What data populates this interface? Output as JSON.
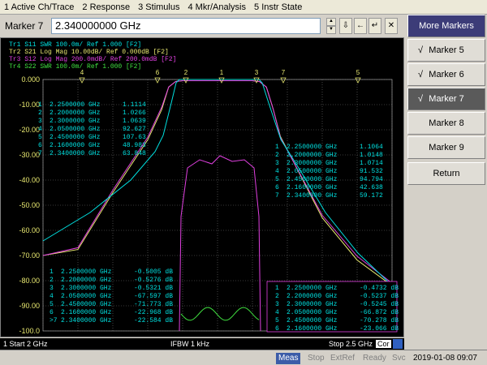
{
  "menu": [
    "1 Active Ch/Trace",
    "2 Response",
    "3 Stimulus",
    "4 Mkr/Analysis",
    "5 Instr State"
  ],
  "entry": {
    "label": "Marker 7",
    "value": "2.340000000 GHz"
  },
  "traces": [
    {
      "text": "Tr1  S11  SWR 100.0m/ Ref 1.000  [F2]",
      "color": "#00e0e0"
    },
    {
      "text": "Tr2  S21  Log Mag 10.00dB/ Ref 0.000dB  [F2]",
      "color": "#e8e870"
    },
    {
      "text": "Tr3  S12  Log Mag 200.0mdB/ Ref 200.0mdB  [F2]",
      "color": "#e040e0"
    },
    {
      "text": "Tr4  S22  SWR 100.0m/ Ref 1.000  [F2]",
      "color": "#40e040"
    }
  ],
  "y_axis": [
    "0.000",
    "-10.00",
    "-20.00",
    "-30.00",
    "-40.00",
    "-50.00",
    "-60.00",
    "-70.00",
    "-80.00",
    "-90.00",
    "-100.0"
  ],
  "colors": {
    "tr1": "#00e0e0",
    "tr2": "#e8e870",
    "tr3": "#e040e0",
    "tr4": "#40e040",
    "tr3_marker_box": "#e040e0"
  },
  "marker_table_swr_left": [
    [
      "1",
      "2.2500000 GHz",
      "1.1114"
    ],
    [
      "2",
      "2.2000000 GHz",
      "1.0266"
    ],
    [
      "3",
      "2.3000000 GHz",
      "1.0639"
    ],
    [
      "4",
      "2.0500000 GHz",
      "92.627"
    ],
    [
      "5",
      "2.4500000 GHz",
      "107.63"
    ],
    [
      "6",
      "2.1600000 GHz",
      "48.983"
    ],
    [
      "7",
      "2.3400000 GHz",
      "63.848"
    ]
  ],
  "marker_table_swr_right": [
    [
      "1",
      "2.2500000 GHz",
      "1.1064"
    ],
    [
      "2",
      "2.2000000 GHz",
      "1.0148"
    ],
    [
      "3",
      "2.3000000 GHz",
      "1.0714"
    ],
    [
      "4",
      "2.0500000 GHz",
      "91.532"
    ],
    [
      "5",
      "2.4500000 GHz",
      "94.794"
    ],
    [
      "6",
      "2.1600000 GHz",
      "42.638"
    ],
    [
      "7",
      "2.3400000 GHz",
      "59.172"
    ]
  ],
  "marker_table_db_left": [
    [
      "1",
      "2.2500000 GHz",
      "-0.5005 dB"
    ],
    [
      "2",
      "2.2000000 GHz",
      "-0.5276 dB"
    ],
    [
      "3",
      "2.3000000 GHz",
      "-0.5321 dB"
    ],
    [
      "4",
      "2.0500000 GHz",
      "-67.597 dB"
    ],
    [
      "5",
      "2.4500000 GHz",
      "-71.773 dB"
    ],
    [
      "6",
      "2.1600000 GHz",
      "-22.968 dB"
    ],
    [
      ">7",
      "2.3400000 GHz",
      "-22.584 dB"
    ]
  ],
  "marker_table_db_right": [
    [
      "1",
      "2.2500000 GHz",
      "-0.4732 dB"
    ],
    [
      "2",
      "2.2000000 GHz",
      "-0.5237 dB"
    ],
    [
      "3",
      "2.3000000 GHz",
      "-0.5245 dB"
    ],
    [
      "4",
      "2.0500000 GHz",
      "-66.872 dB"
    ],
    [
      "5",
      "2.4500000 GHz",
      "-70.278 dB"
    ],
    [
      "6",
      "2.1600000 GHz",
      "-23.066 dB"
    ]
  ],
  "marker_flags_top": [
    "4",
    "6",
    "2",
    "1",
    "3",
    "7",
    "5"
  ],
  "sidepanel": {
    "title": "More Markers",
    "items": [
      {
        "label": "Marker 5",
        "checked": true,
        "active": false
      },
      {
        "label": "Marker 6",
        "checked": true,
        "active": false
      },
      {
        "label": "Marker 7",
        "checked": true,
        "active": true
      },
      {
        "label": "Marker 8",
        "checked": false,
        "active": false
      },
      {
        "label": "Marker 9",
        "checked": false,
        "active": false
      }
    ],
    "return_label": "Return",
    "check_glyph": "√"
  },
  "status": {
    "start": "1  Start 2 GHz",
    "ifbw": "IFBW 1 kHz",
    "stop": "Stop 2.5 GHz",
    "cor": "Cor"
  },
  "bottom": {
    "meas": "Meas",
    "stop": "Stop",
    "extref": "ExtRef",
    "ready": "Ready",
    "svc": "Svc",
    "datetime": "2019-01-08 09:07"
  },
  "chart_data": {
    "type": "line",
    "x_range_ghz": [
      2.0,
      2.5
    ],
    "ylim": [
      -100,
      0
    ],
    "series": [
      {
        "name": "S21",
        "x": [
          2.0,
          2.05,
          2.1,
          2.15,
          2.17,
          2.18,
          2.19,
          2.2,
          2.25,
          2.3,
          2.31,
          2.32,
          2.33,
          2.34,
          2.4,
          2.45,
          2.5
        ],
        "values": [
          -70,
          -67.6,
          -45,
          -24,
          -12,
          -3,
          -0.8,
          -0.5,
          -0.5,
          -0.5,
          -0.8,
          -3,
          -12,
          -22.6,
          -55,
          -71.8,
          -82
        ]
      },
      {
        "name": "S12",
        "x": [
          2.0,
          2.05,
          2.1,
          2.15,
          2.17,
          2.18,
          2.19,
          2.2,
          2.25,
          2.3,
          2.31,
          2.32,
          2.33,
          2.34,
          2.4,
          2.45,
          2.5
        ],
        "values": [
          -70,
          -66.9,
          -44,
          -23,
          -11,
          -3,
          -0.8,
          -0.5,
          -0.5,
          -0.5,
          -0.8,
          -3,
          -12,
          -23,
          -54,
          -70.3,
          -81
        ]
      }
    ]
  }
}
